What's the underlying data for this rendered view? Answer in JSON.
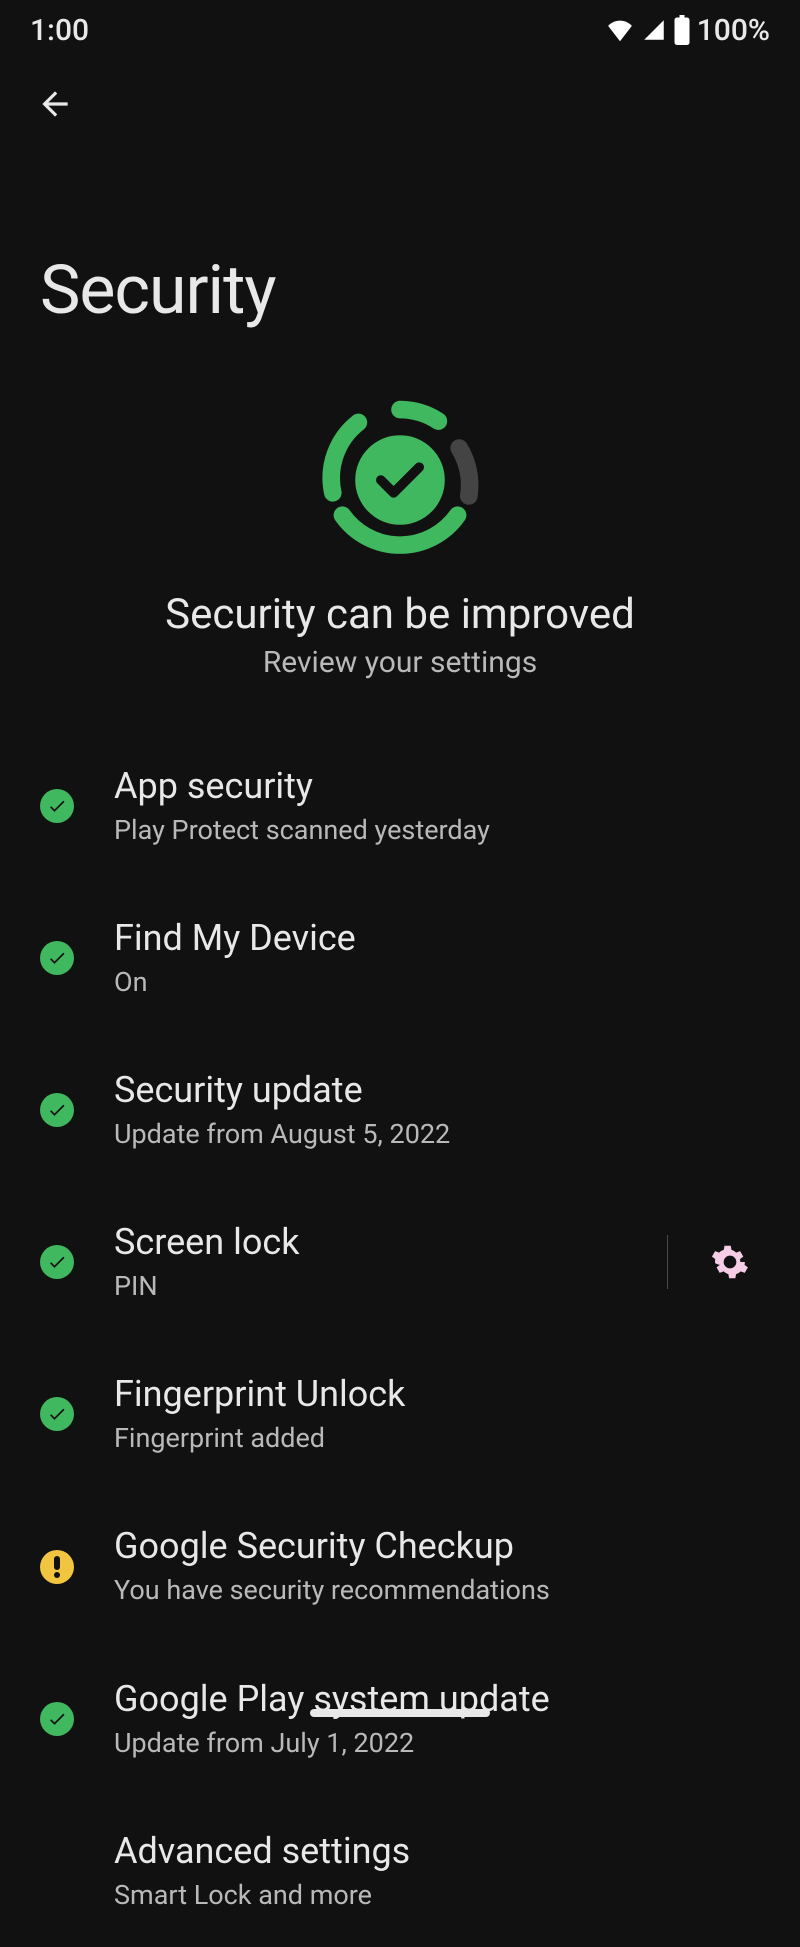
{
  "statusbar": {
    "time": "1:00",
    "battery": "100%"
  },
  "page": {
    "title": "Security"
  },
  "summary": {
    "title": "Security can be improved",
    "subtitle": "Review your settings"
  },
  "items": [
    {
      "status": "ok",
      "title": "App security",
      "sub": "Play Protect scanned yesterday",
      "gear": false
    },
    {
      "status": "ok",
      "title": "Find My Device",
      "sub": "On",
      "gear": false
    },
    {
      "status": "ok",
      "title": "Security update",
      "sub": "Update from August 5, 2022",
      "gear": false
    },
    {
      "status": "ok",
      "title": "Screen lock",
      "sub": "PIN",
      "gear": true
    },
    {
      "status": "ok",
      "title": "Fingerprint Unlock",
      "sub": "Fingerprint added",
      "gear": false
    },
    {
      "status": "warn",
      "title": "Google Security Checkup",
      "sub": "You have security recommendations",
      "gear": false
    },
    {
      "status": "ok",
      "title": "Google Play system update",
      "sub": "Update from July 1, 2022",
      "gear": false
    },
    {
      "status": "none",
      "title": "Advanced settings",
      "sub": "Smart Lock and more",
      "gear": false
    }
  ]
}
